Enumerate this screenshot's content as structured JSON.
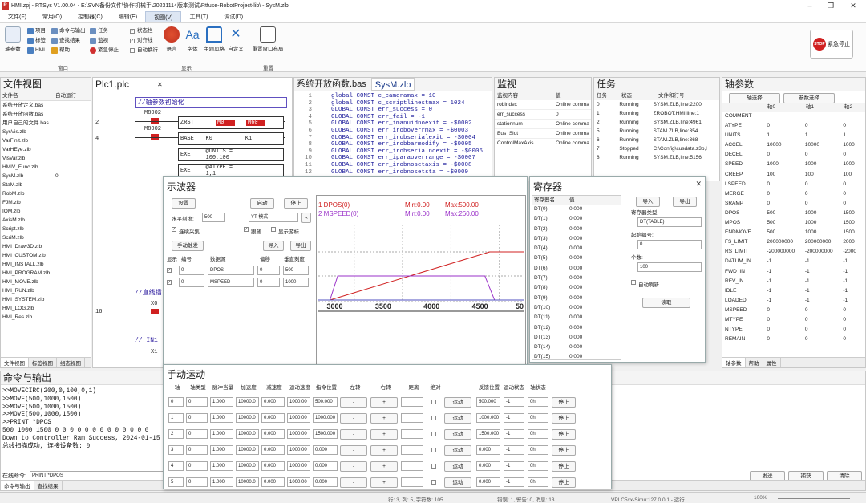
{
  "app": {
    "title": "HMI.zpj - RTSys V1.00.04 - E:\\SVN备份文件\\协作机械手\\20231114版本测试\\Rtfuse-RobotProject-lib\\ - SysM.zlb",
    "icon": "R"
  },
  "menu": [
    "文件(F)",
    "常用(O)",
    "控制器(C)",
    "编辑(E)",
    "视图(V)",
    "工具(T)",
    "调试(D)"
  ],
  "ribbon": {
    "axis_param": "轴参数",
    "win1": [
      "项目",
      "标签",
      "HMI"
    ],
    "win2": [
      "命令与输出",
      "查找结果",
      "帮助"
    ],
    "win3": [
      "任务",
      "监视",
      "紧急停止"
    ],
    "window_group": "窗口",
    "checks": [
      "状态栏",
      "对齐线",
      "自动换行"
    ],
    "display_items": [
      "语言",
      "字体",
      "主题风格",
      "自定义"
    ],
    "display_group": "显示",
    "reset_label": "重置窗口布局",
    "reset_group": "重置",
    "estop": "紧急停止",
    "estop_badge": "STOP"
  },
  "fileview": {
    "title": "文件视图",
    "cols": [
      "文件名",
      "自动运行"
    ],
    "files": [
      [
        "系统开放定义.bas",
        ""
      ],
      [
        "系统开放函数.bas",
        ""
      ],
      [
        "用户自己的文件.bas",
        ""
      ],
      [
        "SysVis.zlb",
        ""
      ],
      [
        "VarFinit.zlb",
        ""
      ],
      [
        "VarHEye.zlb",
        ""
      ],
      [
        "VisVar.zlb",
        ""
      ],
      [
        "HMIV_Func.zlb",
        ""
      ],
      [
        "SysM.zlb",
        "0"
      ],
      [
        "StaM.zlb",
        ""
      ],
      [
        "RobM.zlb",
        ""
      ],
      [
        "FJM.zlb",
        ""
      ],
      [
        "IOM.zlb",
        ""
      ],
      [
        "AxisM.zlb",
        ""
      ],
      [
        "Script.zlb",
        ""
      ],
      [
        "ScriM.zlb",
        ""
      ],
      [
        "HMI_Draw3D.zlb",
        ""
      ],
      [
        "HMI_CUSTOM.zlb",
        ""
      ],
      [
        "HMI_INSTALL.zlb",
        ""
      ],
      [
        "HMI_PROGRAM.zlb",
        ""
      ],
      [
        "HMI_MOVE.zlb",
        ""
      ],
      [
        "HMI_RUN.zlb",
        ""
      ],
      [
        "HMI_SYSTEM.zlb",
        ""
      ],
      [
        "HMI_LOG.zlb",
        ""
      ],
      [
        "HMI_Res.zlb",
        ""
      ]
    ],
    "tabs": [
      "文件视图",
      "标签视图",
      "组态视图"
    ]
  },
  "plc": {
    "tab": "Plc1.plc",
    "comment1": "//轴参数初始化",
    "m1": "M8002",
    "m2": "M8002",
    "rows": [
      [
        "ZRST",
        "M0",
        "M60"
      ],
      [
        "BASE",
        "K0",
        "K1"
      ],
      [
        "EXE",
        "@UNITS = 100,100",
        ""
      ],
      [
        "EXE",
        "@ATYPE = 1,1",
        ""
      ]
    ],
    "nums": [
      "2",
      "4",
      "16"
    ],
    "comment2": "//直线插",
    "x0": "X0",
    "comment3": "// IN1",
    "x1": "X1"
  },
  "code": {
    "tabs": [
      "系统开放函数.bas",
      "SysM.zlb"
    ],
    "lines": [
      [
        "1",
        "global CONST c_cameramax = 10"
      ],
      [
        "2",
        "global CONST c_scriptlinestmax = 1024"
      ],
      [
        "3",
        "GLOBAL CONST err_success = 0"
      ],
      [
        "4",
        "GLOBAL CONST err_fail = -1"
      ],
      [
        "5",
        "GLOBAL CONST err_imanuidnoexit = -$0002"
      ],
      [
        "6",
        "GLOBAL CONST err_iroboverrmax = -$0003"
      ],
      [
        "7",
        "GLOBAL CONST err_irobserialexit = -$0004"
      ],
      [
        "8",
        "GLOBAL CONST err_irobbarmodify = -$0005"
      ],
      [
        "9",
        "GLOBAL CONST err_irobserialnoexit = -$0006"
      ],
      [
        "10",
        "GLOBAL CONST err_iparaoverrange = -$0007"
      ],
      [
        "11",
        "GLOBAL CONST err_irobnosetaxis = -$0008"
      ],
      [
        "12",
        "GLOBAL CONST err_irobnosetsta = -$0009"
      ]
    ]
  },
  "monitor": {
    "title": "监视",
    "cols": [
      "监视内容",
      "值"
    ],
    "rows": [
      [
        "robindex",
        "Online comma"
      ],
      [
        "err_success",
        "0"
      ],
      [
        "stationnum",
        "Online comma"
      ],
      [
        "Bus_Slot",
        "Online comma"
      ],
      [
        "ControlMaxAxis",
        "Online comma"
      ]
    ]
  },
  "tasks": {
    "title": "任务",
    "cols": [
      "任务",
      "状态",
      "文件和行号"
    ],
    "rows": [
      [
        "0",
        "Running",
        "SYSM.ZLB,line:2200"
      ],
      [
        "1",
        "Running",
        "ZROBOT.HMI,line:1"
      ],
      [
        "2",
        "Running",
        "SYSM.ZLB,line:4961"
      ],
      [
        "5",
        "Running",
        "STAM.ZLB,line:354"
      ],
      [
        "6",
        "Running",
        "STAM.ZLB,line:368"
      ],
      [
        "7",
        "Stopped",
        "C:\\Config\\cusdata.z3p,l"
      ],
      [
        "8",
        "Running",
        "SYSM.ZLB,line:5156"
      ]
    ]
  },
  "axisparam": {
    "title": "轴参数",
    "btn1": "轴选择",
    "btn2": "参数选择",
    "cols": [
      "",
      "轴0",
      "轴1",
      "轴2"
    ],
    "rows": [
      [
        "COMMENT",
        "",
        "",
        ""
      ],
      [
        "ATYPE",
        "0",
        "0",
        "0"
      ],
      [
        "UNITS",
        "1",
        "1",
        "1"
      ],
      [
        "ACCEL",
        "10000",
        "10000",
        "1000"
      ],
      [
        "DECEL",
        "0",
        "0",
        "0"
      ],
      [
        "SPEED",
        "1000",
        "1000",
        "1000"
      ],
      [
        "CREEP",
        "100",
        "100",
        "100"
      ],
      [
        "LSPEED",
        "0",
        "0",
        "0"
      ],
      [
        "MERGE",
        "0",
        "0",
        "0"
      ],
      [
        "SRAMP",
        "0",
        "0",
        "0"
      ],
      [
        "DPOS",
        "500",
        "1000",
        "1500"
      ],
      [
        "MPOS",
        "500",
        "1000",
        "1500"
      ],
      [
        "ENDMOVE",
        "500",
        "1000",
        "1500"
      ],
      [
        "FS_LIMIT",
        "200000000",
        "200000000",
        "2000"
      ],
      [
        "RS_LIMIT",
        "-200000000",
        "-200000000",
        "-2000"
      ],
      [
        "DATUM_IN",
        "-1",
        "-1",
        "-1"
      ],
      [
        "FWD_IN",
        "-1",
        "-1",
        "-1"
      ],
      [
        "REV_IN",
        "-1",
        "-1",
        "-1"
      ],
      [
        "IDLE",
        "-1",
        "-1",
        "-1"
      ],
      [
        "LOADED",
        "-1",
        "-1",
        "-1"
      ],
      [
        "MSPEED",
        "0",
        "0",
        "0"
      ],
      [
        "MTYPE",
        "0",
        "0",
        "0"
      ],
      [
        "NTYPE",
        "0",
        "0",
        "0"
      ],
      [
        "REMAIN",
        "0",
        "0",
        "0"
      ]
    ],
    "tabs": [
      "轴参数",
      "帮助",
      "属性"
    ]
  },
  "cmd": {
    "title": "命令与输出",
    "lines": [
      ">>MOVECIRC(200,0,100,0,1)",
      ">>MOVE(500,1000,1500)",
      ">>MOVE(500,1000,1500)",
      ">>MOVE(500,1000,1500)",
      ">>PRINT *DPOS",
      "500 1000 1500 0 0 0 0 0 0 0 0 0 0 0 0 0",
      "Down to Controller Ram Success, 2024-01-15 1",
      "总线扫描成功, 连接设备数:     0"
    ],
    "online_label": "在线命令:",
    "online_value": "PRINT *DPOS",
    "tabs": [
      "命令与输出",
      "查找结果"
    ],
    "send": "发送",
    "capture": "捕获",
    "clear": "清除"
  },
  "scope": {
    "title": "示波器",
    "setup": "设置",
    "start": "启动",
    "stop": "停止",
    "hscale_label": "水平刻度:",
    "hscale": "500",
    "mode": "YT 模式",
    "continuous": "连续采集",
    "follow": "跟随",
    "showscan": "显示游标",
    "manual": "手动触发",
    "import": "导入",
    "export": "导出",
    "cols": [
      "显示",
      "编号",
      "数据源",
      "偏移",
      "垂直刻度"
    ],
    "chans": [
      [
        "0",
        "DPOS",
        "0",
        "500"
      ],
      [
        "0",
        "MSPEED",
        "0",
        "1000"
      ]
    ],
    "legend": [
      {
        "name": "1 DPOS(0)",
        "min": "Min:0.00",
        "max": "Max:500.00",
        "color": "#d02020"
      },
      {
        "name": "2 MSPEED(0)",
        "min": "Min:0.00",
        "max": "Max:260.00",
        "color": "#9a30c8"
      }
    ],
    "ticks": [
      "3000",
      "3500",
      "4000",
      "4500",
      "50"
    ]
  },
  "chart_data": {
    "type": "line",
    "x_ticks": [
      3000,
      3500,
      4000,
      4500
    ],
    "series": [
      {
        "name": "1 DPOS(0)",
        "x": [
          3000,
          4650,
          5000
        ],
        "y": [
          0,
          500,
          500
        ]
      },
      {
        "name": "2 MSPEED(0)",
        "x": [
          3000,
          3080,
          4600,
          4700
        ],
        "y": [
          0,
          260,
          260,
          0
        ]
      }
    ]
  },
  "regs": {
    "title": "寄存器",
    "cols": [
      "寄存器名",
      "值"
    ],
    "names": [
      "DT(0)",
      "DT(1)",
      "DT(2)",
      "DT(3)",
      "DT(4)",
      "DT(5)",
      "DT(6)",
      "DT(7)",
      "DT(8)",
      "DT(9)",
      "DT(10)",
      "DT(11)",
      "DT(12)",
      "DT(13)",
      "DT(14)",
      "DT(15)"
    ],
    "value": "0.000",
    "import": "导入",
    "export": "导出",
    "type_label": "寄存器类型:",
    "type": "DT(TABLE)",
    "start_label": "起始编号:",
    "start": "0",
    "count_label": "个数:",
    "count": "100",
    "auto": "自动刷新",
    "read": "读取"
  },
  "manual": {
    "title": "手动运动",
    "cols": [
      "轴",
      "轴类型",
      "脉冲当量",
      "加速度",
      "减速度",
      "运动速度",
      "指令位置",
      "左转",
      "右转",
      "距离",
      "绝对",
      "",
      "反馈位置",
      "运动状态",
      "轴状态",
      ""
    ],
    "rows": [
      [
        "0",
        "0",
        "1.000",
        "10000.0",
        "0.000",
        "1000.00",
        "500.000",
        "500.000",
        "-1",
        "0h"
      ],
      [
        "1",
        "0",
        "1.000",
        "10000.0",
        "0.000",
        "1000.00",
        "1000.000",
        "1000.000",
        "-1",
        "0h"
      ],
      [
        "2",
        "0",
        "1.000",
        "10000.0",
        "0.000",
        "1000.00",
        "1500.000",
        "1500.000",
        "-1",
        "0h"
      ],
      [
        "3",
        "0",
        "1.000",
        "10000.0",
        "0.000",
        "1000.00",
        "0.000",
        "0.000",
        "-1",
        "0h"
      ],
      [
        "4",
        "0",
        "1.000",
        "10000.0",
        "0.000",
        "1000.00",
        "0.000",
        "0.000",
        "-1",
        "0h"
      ],
      [
        "5",
        "0",
        "1.000",
        "10000.0",
        "0.000",
        "1000.00",
        "0.000",
        "0.000",
        "-1",
        "0h"
      ]
    ],
    "minus": "-",
    "plus": "+",
    "run": "运动",
    "stop": "停止"
  },
  "status": {
    "pos": "行: 3, 列: 5, 字符数: 105",
    "err": "错误: 1, 警告: 0, 消息: 13",
    "ctrl": "VPLC5xx-Simu:127.0.0.1 - 运行",
    "zoom": "100%"
  }
}
